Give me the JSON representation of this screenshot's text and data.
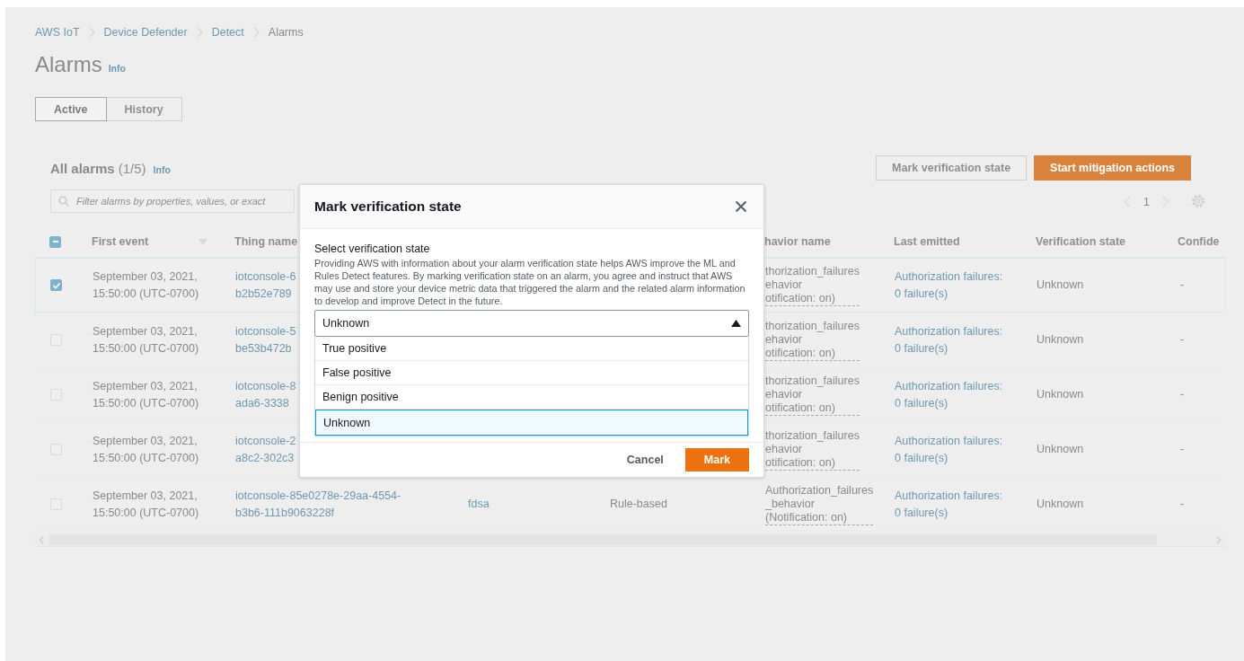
{
  "breadcrumbs": [
    "AWS IoT",
    "Device Defender",
    "Detect",
    "Alarms"
  ],
  "page_title": "Alarms",
  "page_info": "Info",
  "tabs": [
    {
      "label": "Active",
      "selected": true
    },
    {
      "label": "History",
      "selected": false
    }
  ],
  "alarms_panel": {
    "title": "All alarms",
    "count": "(1/5)",
    "info": "Info",
    "buttons": [
      {
        "label": "Mark verification state",
        "kind": "normal"
      },
      {
        "label": "Start mitigation actions",
        "kind": "primary"
      }
    ],
    "search": {
      "placeholder": "Filter alarms by properties, values, or exact"
    },
    "pagination": {
      "page": "1"
    }
  },
  "table": {
    "select_all": {
      "checked": true,
      "partial": true
    },
    "columns": [
      "First event",
      "Thing name",
      "havior name",
      "Last emitted",
      "Verification state",
      "Confide"
    ],
    "rows": [
      {
        "selected": true,
        "checked": true,
        "first_event": "September 03, 2021, 15:50:00 (UTC-0700)",
        "thing_name": [
          "iotconsole-6",
          "b2b52e789"
        ],
        "behavior_name": [
          "thorization_failures",
          "ehavior",
          "otification: on)"
        ],
        "last_emitted": [
          "Authorization failures:",
          "0 failure(s)"
        ],
        "verification_state": "Unknown",
        "column_9": "-"
      },
      {
        "selected": false,
        "checked": false,
        "first_event": "September 03, 2021, 15:50:00 (UTC-0700)",
        "thing_name": [
          "iotconsole-5",
          "be53b472b"
        ],
        "behavior_name": [
          "thorization_failures",
          "ehavior",
          "otification: on)"
        ],
        "last_emitted": [
          "Authorization failures:",
          "0 failure(s)"
        ],
        "verification_state": "Unknown",
        "column_9": "-"
      },
      {
        "selected": false,
        "checked": false,
        "first_event": "September 03, 2021, 15:50:00 (UTC-0700)",
        "thing_name": [
          "iotconsole-8",
          "ada6-3338"
        ],
        "behavior_name": [
          "thorization_failures",
          "ehavior",
          "otification: on)"
        ],
        "last_emitted": [
          "Authorization failures:",
          "0 failure(s)"
        ],
        "verification_state": "Unknown",
        "column_9": "-"
      },
      {
        "selected": false,
        "checked": false,
        "first_event": "September 03, 2021, 15:50:00 (UTC-0700)",
        "thing_name": [
          "iotconsole-2",
          "a8c2-302c3"
        ],
        "behavior_name": [
          "thorization_failures",
          "ehavior",
          "otification: on)"
        ],
        "last_emitted": [
          "Authorization failures:",
          "0 failure(s)"
        ],
        "verification_state": "Unknown",
        "column_9": "-"
      },
      {
        "selected": false,
        "checked": false,
        "first_event": "September 03, 2021, 15:50:00 (UTC-0700)",
        "thing_name": [
          "iotconsole-85e0278e-29aa-4554-",
          "b3b6-111b9063228f"
        ],
        "column_3": "fdsa",
        "column_4": "Rule-based",
        "behavior_name": [
          "Authorization_failures",
          "_behavior",
          "(Notification: on)"
        ],
        "last_emitted": [
          "Authorization failures:",
          "0 failure(s)"
        ],
        "verification_state": "Unknown",
        "column_9": "-"
      }
    ]
  },
  "modal": {
    "title": "Mark verification state",
    "field_label": "Select verification state",
    "description": "Providing AWS with information about your alarm verification state helps AWS improve the ML and Rules Detect features. By marking verification state on an alarm, you agree and instruct that AWS may use and store your device metric data that triggered the alarm and the related alarm information to develop and improve Detect in the future.",
    "select": {
      "value": "Unknown",
      "expanded": true
    },
    "options": [
      {
        "label": "True positive",
        "selected": false
      },
      {
        "label": "False positive",
        "selected": false
      },
      {
        "label": "Benign positive",
        "selected": false
      },
      {
        "label": "Unknown",
        "selected": true
      }
    ],
    "buttons": [
      {
        "label": "Cancel",
        "kind": "link"
      },
      {
        "label": "Mark",
        "kind": "primary"
      }
    ]
  }
}
